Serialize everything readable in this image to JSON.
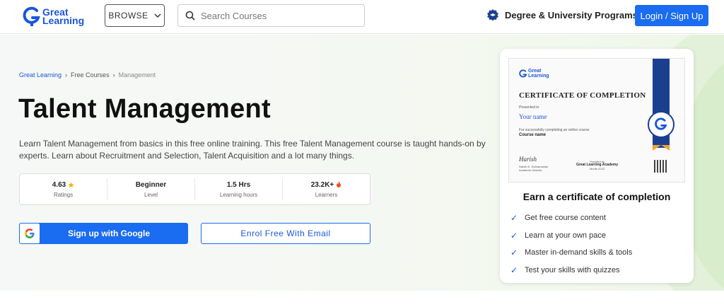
{
  "header": {
    "logo_line1": "Great",
    "logo_line2": "Learning",
    "browse_label": "BROWSE",
    "search_placeholder": "Search Courses",
    "degree_label": "Degree & University Programs",
    "login_label": "Login / Sign Up"
  },
  "breadcrumb": [
    "Great Learning",
    "Free Courses",
    "Management"
  ],
  "course": {
    "title": "Talent Management",
    "description": "Learn Talent Management from basics in this free online training. This free Talent Management course is taught hands-on by experts. Learn about Recruitment and Selection, Talent Acquisition and a lot many things."
  },
  "stats": [
    {
      "value": "4.63",
      "label": "Ratings",
      "icon": "star-icon"
    },
    {
      "value": "Beginner",
      "label": "Level"
    },
    {
      "value": "1.5 Hrs",
      "label": "Learning hours"
    },
    {
      "value": "23.2K+",
      "label": "Learners",
      "icon": "fire-icon"
    }
  ],
  "buttons": {
    "google_label": "Sign up with Google",
    "email_label": "Enrol Free With Email"
  },
  "certificate": {
    "logo_line1": "Great",
    "logo_line2": "Learning",
    "heading": "CERTIFICATE OF COMPLETION",
    "presented_to": "Presented to",
    "recipient": "Your name",
    "for_text": "For successfully completing an online course",
    "course_name": "Course name",
    "signer_name": "Harish K. Subramanian",
    "signer_role": "Academic Director",
    "provided_by": "Provided by",
    "provider": "Great Learning Academy",
    "date": "Month 2023"
  },
  "card": {
    "title": "Earn a certificate of completion",
    "perks": [
      "Get free course content",
      "Learn at your own pace",
      "Master in-demand skills & tools",
      "Test your skills with quizzes"
    ]
  },
  "colors": {
    "primary": "#1a6cf0",
    "star": "#f5b301",
    "fire": "#f04e23",
    "ribbon": "#1b3f8f"
  }
}
